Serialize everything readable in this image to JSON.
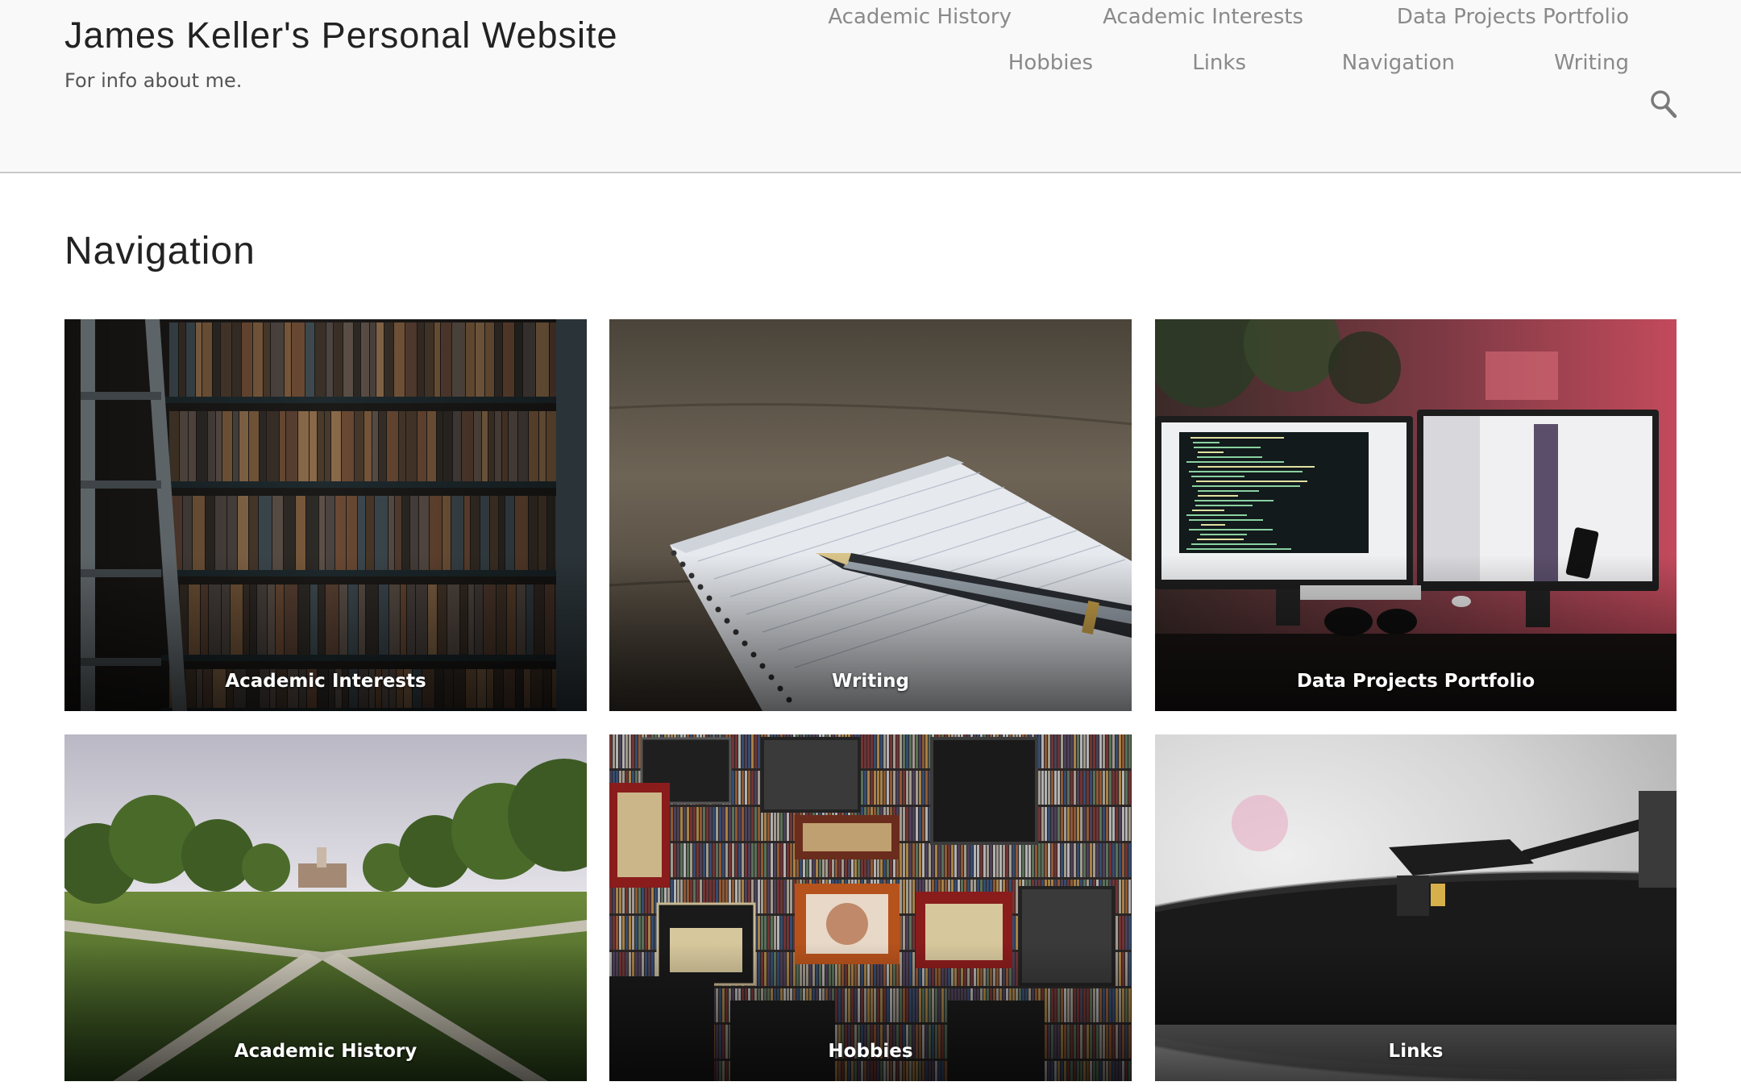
{
  "site": {
    "title": "James Keller's Personal Website",
    "description": "For info about me."
  },
  "nav": {
    "row1": [
      "Academic History",
      "Academic Interests",
      "Data Projects Portfolio"
    ],
    "row2": [
      "Hobbies",
      "Links",
      "Navigation",
      "Writing"
    ],
    "search_icon": "search-icon"
  },
  "page": {
    "title": "Navigation"
  },
  "cards": [
    {
      "label": "Academic Interests",
      "image": "bookshelf-photo"
    },
    {
      "label": "Writing",
      "image": "notebook-pen-photo"
    },
    {
      "label": "Data Projects Portfolio",
      "image": "monitors-desk-photo"
    },
    {
      "label": "Academic History",
      "image": "campus-quad-photo"
    },
    {
      "label": "Hobbies",
      "image": "amps-records-photo"
    },
    {
      "label": "Links",
      "image": "turntable-photo"
    }
  ],
  "colors": {
    "header_bg": "#f9f9f9",
    "nav_link": "#8a8a8a",
    "title_text": "#222222"
  }
}
